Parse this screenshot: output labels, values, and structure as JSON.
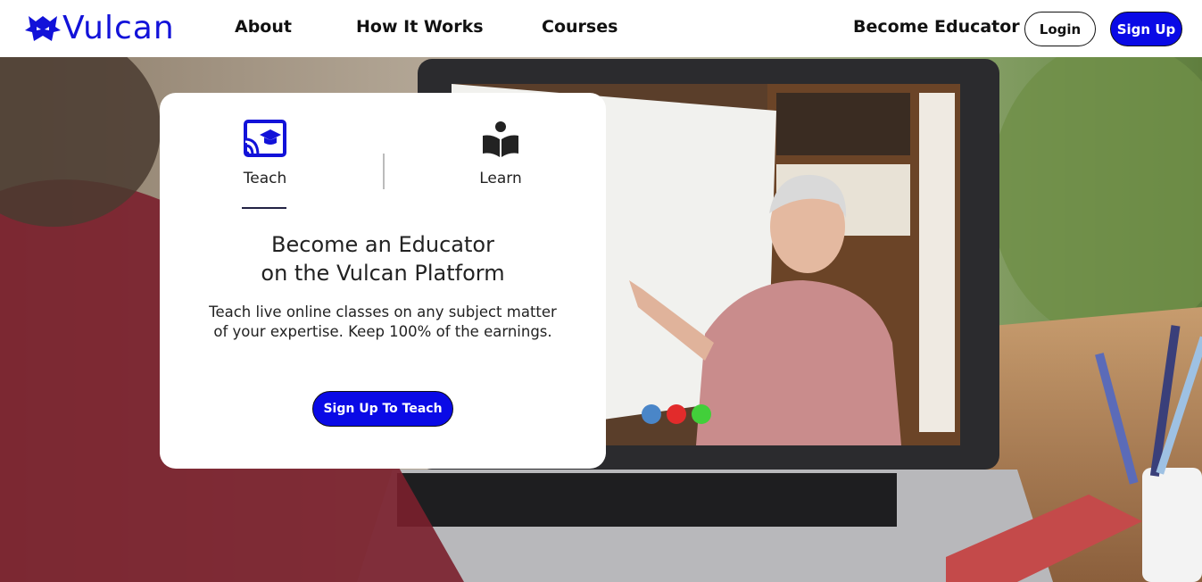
{
  "header": {
    "logo_text": "Vulcan",
    "nav": [
      {
        "label": "About"
      },
      {
        "label": "How It Works"
      },
      {
        "label": "Courses"
      }
    ],
    "become_educator": "Become Educator",
    "login_label": "Login",
    "signup_label": "Sign Up"
  },
  "card": {
    "tabs": [
      {
        "label": "Teach",
        "icon": "cast-education-icon",
        "active": true
      },
      {
        "label": "Learn",
        "icon": "reader-book-icon",
        "active": false
      }
    ],
    "title_line1": "Become an Educator",
    "title_line2": "on the Vulcan Platform",
    "desc_line1": "Teach live online classes on any subject matter",
    "desc_line2": "of your expertise. Keep 100% of the earnings.",
    "cta_label": "Sign Up To Teach"
  },
  "colors": {
    "brand": "#1212d9",
    "primary_button": "#0a0ae6",
    "text": "#222222"
  }
}
